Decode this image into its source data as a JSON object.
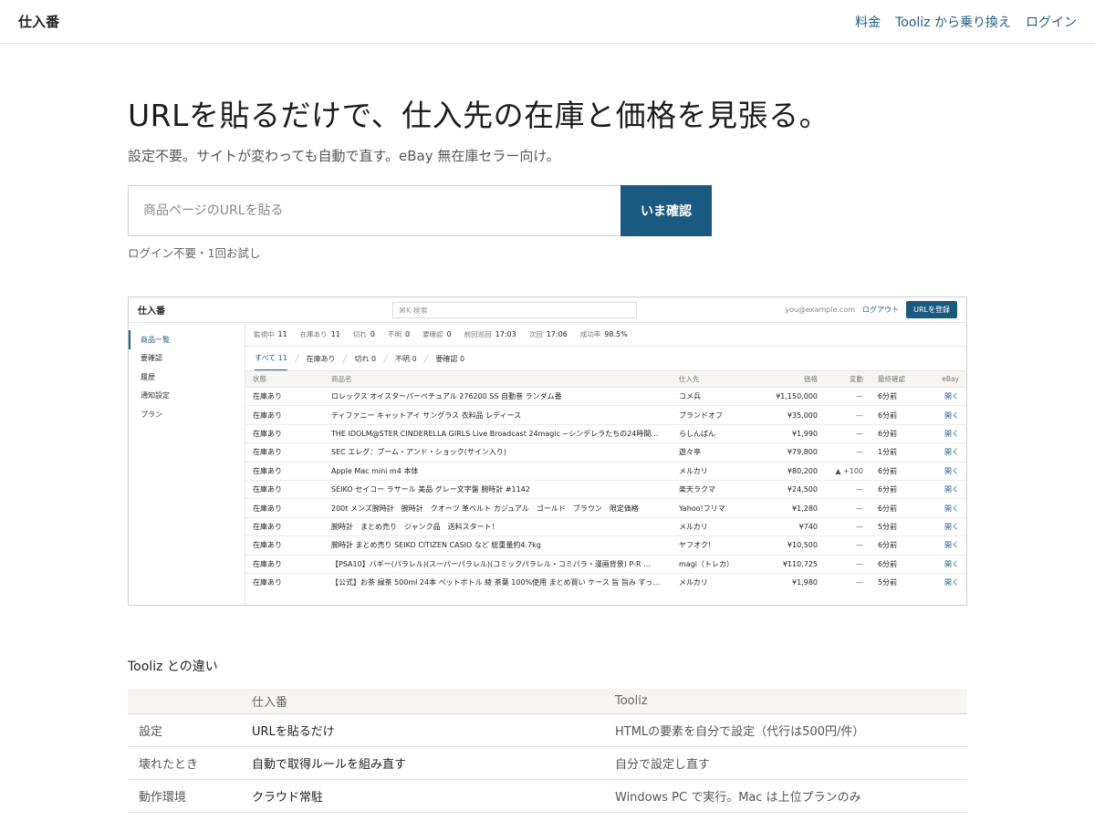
{
  "header": {
    "brand": "仕入番",
    "nav": [
      "料金",
      "Tooliz から乗り換え",
      "ログイン"
    ]
  },
  "hero": {
    "title": "URLを貼るだけで、仕入先の在庫と価格を見張る。",
    "subtitle": "設定不要。サイトが変わっても自動で直す。eBay 無在庫セラー向け。",
    "input_placeholder": "商品ページのURLを貼る",
    "button": "いま確認",
    "hint": "ログイン不要・1回お試し"
  },
  "preview": {
    "brand": "仕入番",
    "search_placeholder": "⌘K 検索",
    "email": "you@example.com",
    "logout": "ログアウト",
    "register": "URLを登録",
    "sidebar": [
      "商品一覧",
      "要確認",
      "履歴",
      "通知設定",
      "プラン"
    ],
    "stats": [
      {
        "label": "監視中",
        "value": "11"
      },
      {
        "label": "在庫あり",
        "value": "11"
      },
      {
        "label": "切れ",
        "value": "0"
      },
      {
        "label": "不明",
        "value": "0"
      },
      {
        "label": "要確認",
        "value": "0"
      },
      {
        "label": "前回巡回",
        "value": "17:03"
      },
      {
        "label": "次回",
        "value": "17:06"
      },
      {
        "label": "成功率",
        "value": "98.5%"
      }
    ],
    "tabs": [
      "すべて 11",
      "在庫あり",
      "切れ 0",
      "不明 0",
      "要確認 0"
    ],
    "columns": [
      "状態",
      "商品名",
      "仕入先",
      "価格",
      "変動",
      "最終確認",
      "eBay"
    ],
    "rows": [
      {
        "status": "在庫あり",
        "name": "ロレックス オイスターパーペチュアル 276200 SS 自動巻 ランダム番",
        "supplier": "コメ兵",
        "price": "¥1,150,000",
        "change": "—",
        "checked": "6分前",
        "ebay": "開く"
      },
      {
        "status": "在庫あり",
        "name": "ティファニー キャットアイ サングラス 衣料品 レディース",
        "supplier": "ブランドオフ",
        "price": "¥35,000",
        "change": "—",
        "checked": "6分前",
        "ebay": "開く"
      },
      {
        "status": "在庫あり",
        "name": "THE IDOLM@STER CINDERELLA GIRLS Live Broadcast 24magic ~シンデレラたちの24時間…",
        "supplier": "らしんばん",
        "price": "¥1,990",
        "change": "—",
        "checked": "6分前",
        "ebay": "開く"
      },
      {
        "status": "在庫あり",
        "name": "SEC エレグ：ブーム・アンド・ショック(サイン入り)",
        "supplier": "遊々亭",
        "price": "¥79,800",
        "change": "—",
        "checked": "1分前",
        "ebay": "開く"
      },
      {
        "status": "在庫あり",
        "name": "Apple Mac mini m4 本体",
        "supplier": "メルカリ",
        "price": "¥80,200",
        "change": "▲ +100",
        "checked": "6分前",
        "ebay": "開く"
      },
      {
        "status": "在庫あり",
        "name": "SEIKO セイコー ラサール 美品 グレー文字盤 腕時計 #1142",
        "supplier": "楽天ラクマ",
        "price": "¥24,500",
        "change": "—",
        "checked": "6分前",
        "ebay": "開く"
      },
      {
        "status": "在庫あり",
        "name": "200t メンズ腕時計　腕時計　クオーツ 革ベルト カジュアル　ゴールド　ブラウン　限定価格",
        "supplier": "Yahoo!フリマ",
        "price": "¥1,280",
        "change": "—",
        "checked": "6分前",
        "ebay": "開く"
      },
      {
        "status": "在庫あり",
        "name": "腕時計　まとめ売り　ジャンク品　送料スタート！",
        "supplier": "メルカリ",
        "price": "¥740",
        "change": "—",
        "checked": "5分前",
        "ebay": "開く"
      },
      {
        "status": "在庫あり",
        "name": "腕時計 まとめ売り SEIKO CITIZEN CASIO など 総重量約4.7kg",
        "supplier": "ヤフオク!",
        "price": "¥10,500",
        "change": "—",
        "checked": "6分前",
        "ebay": "開く"
      },
      {
        "status": "在庫あり",
        "name": "【PSA10】バギー(パラレル)(スーパーパラレル)(コミックパラレル・コミパラ・漫画背景) P-R …",
        "supplier": "magi（トレカ）",
        "price": "¥110,725",
        "change": "—",
        "checked": "6分前",
        "ebay": "開く"
      },
      {
        "status": "在庫あり",
        "name": "【公式】お茶 緑茶 500ml 24本 ペットボトル 綾 茶葉 100%使用 まとめ買い ケース 旨 旨み すっ…",
        "supplier": "メルカリ",
        "price": "¥1,980",
        "change": "—",
        "checked": "5分前",
        "ebay": "開く"
      }
    ]
  },
  "comparison": {
    "title": "Tooliz との違い",
    "columns": [
      "",
      "仕入番",
      "Tooliz"
    ],
    "rows": [
      {
        "label": "設定",
        "ours": "URLを貼るだけ",
        "theirs": "HTMLの要素を自分で設定（代行は500円/件）"
      },
      {
        "label": "壊れたとき",
        "ours": "自動で取得ルールを組み直す",
        "theirs": "自分で設定し直す"
      },
      {
        "label": "動作環境",
        "ours": "クラウド常駐",
        "theirs": "Windows PC で実行。Mac は上位プランのみ"
      }
    ]
  },
  "colors": {
    "accent": "#1b5a80",
    "link": "#1f5f86",
    "header_bg": "#f6f5f2"
  }
}
